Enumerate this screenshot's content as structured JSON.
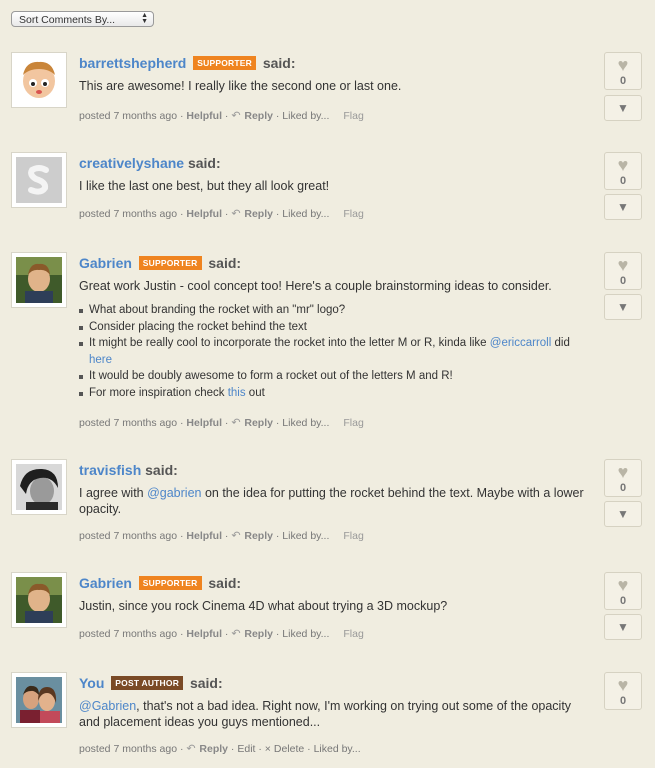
{
  "sort": {
    "label": "Sort Comments By...",
    "arrows": "▲▼"
  },
  "labels": {
    "said": "said:",
    "helpful": "Helpful",
    "reply": "Reply",
    "liked": "Liked by...",
    "flag": "Flag",
    "edit": "Edit",
    "delete": "Delete",
    "delete_mark": "×",
    "sep": " · ",
    "reply_icon": "↶",
    "heart": "♥",
    "down": "▼"
  },
  "comments": [
    {
      "user": "barrettshepherd",
      "badge": "SUPPORTER",
      "text": "This are awesome! I really like the second one or last one.",
      "posted": "posted 7 months ago",
      "votes": "0",
      "avatar": "cartoon"
    },
    {
      "user": "creativelyshane",
      "badge": "",
      "text": "I like the last one best, but they all look great!",
      "posted": "posted 7 months ago",
      "votes": "0",
      "avatar": "s-logo"
    },
    {
      "user": "Gabrien",
      "badge": "SUPPORTER",
      "text": "Great work Justin - cool concept too! Here's a couple brainstorming ideas to consider.",
      "bullets": [
        "What about branding the rocket with an \"mr\" logo?",
        "Consider placing the rocket behind the text"
      ],
      "bullet3_pre": "It might be really cool to incorporate the rocket into the letter M or R, kinda like ",
      "bullet3_mention": "@ericcarroll",
      "bullet3_mid": " did ",
      "bullet3_link": "here",
      "bullet4": "It would be doubly awesome to form a rocket out of the letters M and R!",
      "bullet5_pre": "For more inspiration check ",
      "bullet5_link": "this",
      "bullet5_post": " out",
      "posted": "posted 7 months ago",
      "votes": "0",
      "avatar": "photo-man"
    },
    {
      "user": "travisfish",
      "badge": "",
      "text_pre": "I agree with ",
      "mention": "@gabrien",
      "text_post": " on the idea for putting the rocket behind the text. Maybe with a lower opacity.",
      "posted": "posted 7 months ago",
      "votes": "0",
      "avatar": "photo-bw"
    },
    {
      "user": "Gabrien",
      "badge": "SUPPORTER",
      "text": "Justin, since you rock Cinema 4D what about trying a 3D mockup?",
      "posted": "posted 7 months ago",
      "votes": "0",
      "avatar": "photo-man"
    },
    {
      "user": "You",
      "badge": "POST AUTHOR",
      "mention": "@Gabrien",
      "text_post": ", that's not a bad idea. Right now, I'm working on trying out some of the opacity and placement ideas you guys mentioned...",
      "posted": "posted 7 months ago",
      "votes": "0",
      "avatar": "photo-couple"
    }
  ],
  "colors": {
    "link": "#4d86c9",
    "supporter": "#ef8420",
    "author": "#7a4a26",
    "background": "#f0ede0"
  }
}
